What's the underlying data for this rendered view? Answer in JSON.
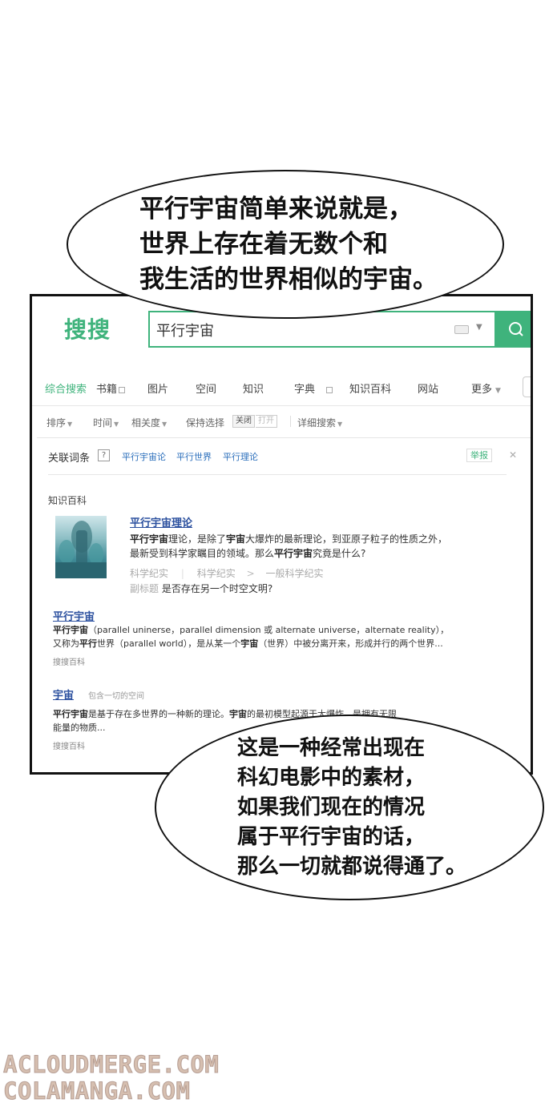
{
  "bubble_top": {
    "lines": [
      "平行宇宙简单来说就是，",
      "世界上存在着无数个和",
      "我生活的世界相似的宇宙。"
    ]
  },
  "bubble_bottom": {
    "lines": [
      "这是一种经常出现在",
      "科幻电影中的素材，",
      "如果我们现在的情况",
      "属于平行宇宙的话，",
      "那么一切就都说得通了。"
    ]
  },
  "browser": {
    "logo": "搜搜",
    "search_value": "平行宇宙",
    "tabs": [
      "综合搜索",
      "书籍",
      "图片",
      "空间",
      "知识",
      "字典",
      "知识百科",
      "网站",
      "更多"
    ],
    "filters": {
      "sort": "排序",
      "time": "时间",
      "relevance": "相关度",
      "keep": "保持选择",
      "on": "关闭",
      "off": "打开",
      "advanced": "详细搜索"
    },
    "related": {
      "title": "关联词条",
      "help": "?",
      "items": [
        "平行宇宙论",
        "平行世界",
        "平行理论"
      ],
      "report": "举报"
    },
    "section_title": "知识百科",
    "result1": {
      "title": "平行宇宙理论",
      "line1_a": "平行宇宙",
      "line1_b": "理论，是除了",
      "line1_c": "宇宙",
      "line1_d": "大爆炸的最新理论，到亚原子粒子的性质之外，",
      "line2_a": "最新受到科学家瞩目的领域。那么",
      "line2_b": "平行宇宙",
      "line2_c": "究竟是什么?",
      "meta1": "科学纪实",
      "meta2": "科学纪实",
      "meta3": "一般科学纪实",
      "sub_label": "副标题",
      "sub_text": "是否存在另一个时空文明?"
    },
    "result2": {
      "title": "平行宇宙",
      "line1_a": "平行宇宙",
      "line1_b": "（parallel uninerse，parallel dimension 或 alternate universe，alternate reality），",
      "line2_a": "又称为",
      "line2_b": "平行",
      "line2_c": "世界（parallel world），是从某一个",
      "line2_d": "宇宙",
      "line2_e": "（世界）中被分离开来，形成并行的两个世界...",
      "source": "搜搜百科"
    },
    "result3": {
      "title": "宇宙",
      "tag": "包含一切的空间",
      "line1_a": "平行宇宙",
      "line1_b": "是基于存在多世界的一种新的理论。",
      "line1_c": "宇宙",
      "line1_d": "的最初模型起源于大爆炸，是拥有无限",
      "line2": "能量的物质...",
      "source": "搜搜百科"
    }
  },
  "watermark": {
    "line1": "ACLOUDMERGE.COM",
    "line2": "COLAMANGA.COM"
  },
  "colors": {
    "brand_green": "#3fb37c",
    "link_blue": "#2a4f9e"
  }
}
